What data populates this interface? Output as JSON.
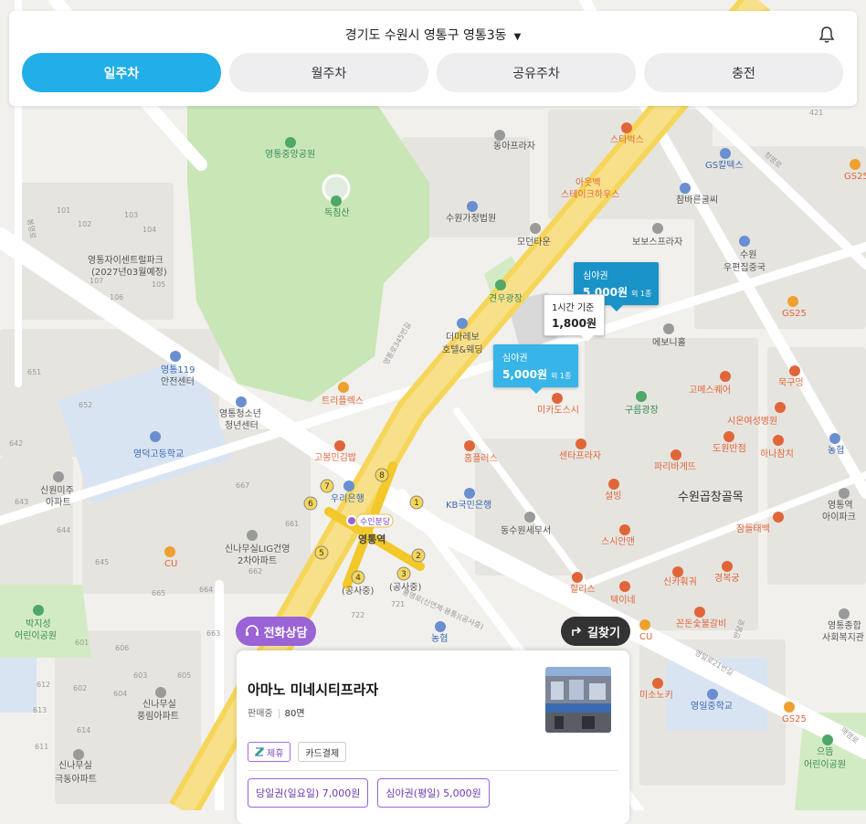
{
  "header": {
    "location": "경기도 수원시 영통구 영통3동",
    "tabs": [
      {
        "label": "일주차",
        "active": true
      },
      {
        "label": "월주차",
        "active": false
      },
      {
        "label": "공유주차",
        "active": false
      },
      {
        "label": "충전",
        "active": false
      }
    ]
  },
  "colors": {
    "accent": "#22aee8",
    "marker": "#1a93c8",
    "consult": "#9a63d6",
    "route": "#333333"
  },
  "markers": [
    {
      "type": "심야권",
      "price": "5,000원",
      "extra": "외 1종"
    },
    {
      "type": "1시간 기준",
      "price": "1,800원",
      "extra": ""
    },
    {
      "type": "심야권",
      "price": "5,000원",
      "extra": "외 1종"
    }
  ],
  "map_labels": {
    "park": "영통중앙공원",
    "mountain": "독침산",
    "court": "수원가정법원",
    "dong_plaza": "동아프라자",
    "starbucks": "스타벅스",
    "outback": "아웃백\n스테이크하우스",
    "gs_caltex": "GS칼텍스",
    "chambarun": "참바른굴씨",
    "bobos": "보보스프라자",
    "modern_town": "모던타운",
    "gyeonwoo": "견우광장",
    "post_office": "수원\n우편집중국",
    "the_marebo": "더마레보\n호텔&웨딩",
    "yeongtong_central": "영통자이센트럴파크\n(2027년03월예정)",
    "fire_center": "영통119\n안전센터",
    "youth_center": "영통청소년\n청년센터",
    "triplex": "트리플렉스",
    "gobong": "고봉민김밥",
    "woori": "우리은행",
    "homeplus": "홈플러스",
    "kb": "KB국민은행",
    "tax_office": "동수원세무서",
    "mikado": "미카도스시",
    "gureum": "구름광장",
    "centapla": "센타프라자",
    "paris": "파리바게뜨",
    "sulbing": "설빙",
    "sushi_anyang": "스시안앤",
    "gopchang": "수원곱창골목",
    "yeongdeok_high": "영덕고등학교",
    "sinwon": "신원미주\n아파트",
    "sinamusil_lig": "신나무실LIG건영\n2차아파트",
    "station": "영통역",
    "station_tag": "수인분당",
    "construction1": "(공사중)",
    "construction2": "(공사중)",
    "bakji": "박지성\n어린이공원",
    "sinamusil_pungrim": "신나무실\n풍림아파트",
    "sinamusil_geukdong": "신나무실\n극동아파트",
    "youngil_middle": "영일중학교",
    "ueum_park": "으뜸\n어린이공원",
    "yeongtong_general": "영통종합\n사회복지관",
    "yeongtong_apt": "영통역\n아이파크",
    "sion": "시온여성병원",
    "hana": "하나참치",
    "nh1": "농협",
    "nh2": "농협",
    "gomes": "고메스퀘어",
    "mukgu": "묵구멍",
    "dowon": "도원반점",
    "sinka": "신카훠궈",
    "gyeongbok": "경복궁",
    "hallis": "할리스",
    "teoknae": "텍이네",
    "kkonbon": "꼰돈숯불갈비",
    "misonoki": "미소노키",
    "jamstick": "잠들태백",
    "ebneul": "에보니홀",
    "cu1": "CU",
    "cu2": "CU",
    "gs25_1": "GS25",
    "gs25_2": "GS25",
    "gs25_3": "GS25",
    "blocks": [
      "101",
      "102",
      "103",
      "104",
      "105",
      "106",
      "107",
      "421",
      "651",
      "652",
      "642",
      "643",
      "644",
      "645",
      "661",
      "662",
      "663",
      "664",
      "665",
      "667",
      "601",
      "602",
      "603",
      "604",
      "605",
      "606",
      "614",
      "611",
      "721",
      "722",
      "613",
      "612"
    ],
    "road1": "영통로345번길",
    "road2": "청명로",
    "road3": "봉영로",
    "road4": "반달로",
    "road5": "영일로21번길",
    "road6": "매영로",
    "road7": "봉영로(신연제·용통)(공사중)"
  },
  "consult_button": {
    "label": "전화상담"
  },
  "route_button": {
    "label": "길찾기"
  },
  "card": {
    "name": "아마노 미네시티프라자",
    "status": "판매중",
    "capacity": "80면",
    "chips": [
      {
        "label": "제휴",
        "partner": true
      },
      {
        "label": "카드결제",
        "partner": false
      }
    ],
    "prices": [
      {
        "label": "당일권(일요일) 7,000원"
      },
      {
        "label": "심야권(평일) 5,000원"
      }
    ]
  }
}
